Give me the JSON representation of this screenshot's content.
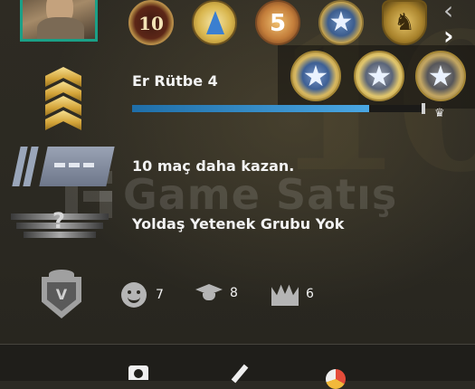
{
  "background": {
    "watermark_text": "Game Satış"
  },
  "coins": [
    {
      "name": "10-year-veteran-coin",
      "text": "10"
    },
    {
      "name": "service-medal-coin",
      "text": ""
    },
    {
      "name": "5-year-veteran-coin",
      "text": "5"
    },
    {
      "name": "star-medal-coin",
      "text": ""
    },
    {
      "name": "operation-shield-coin",
      "text": ""
    }
  ],
  "rank": {
    "label": "Er Rütbe 4",
    "xp_progress_fraction": 0.82
  },
  "competitive": {
    "wins_text": "10 maç daha kazan."
  },
  "wingman": {
    "group_text": "Yoldaş Yetenek Grubu Yok"
  },
  "commendations": {
    "friendly": "7",
    "teacher": "8",
    "leader": "6"
  },
  "colors": {
    "avatar_border": "#1aa087",
    "xp_bar": "#4aa7e3",
    "rank_gold": "#d4a53a"
  }
}
